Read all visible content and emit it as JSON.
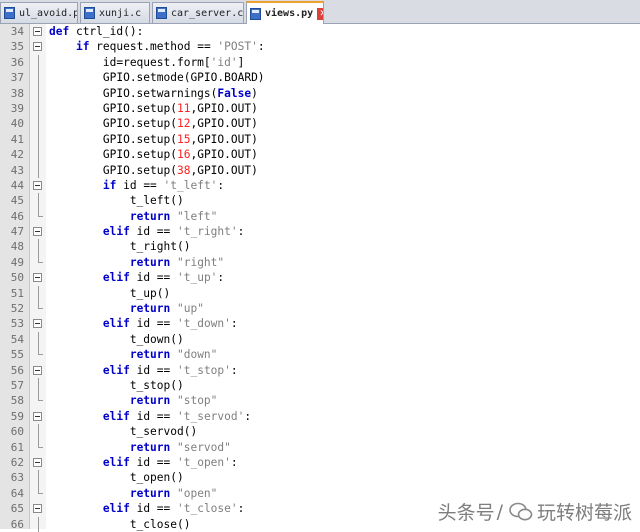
{
  "tabs": [
    {
      "label": "ul_avoid.py",
      "active": false
    },
    {
      "label": "xunji.c",
      "active": false
    },
    {
      "label": "car_server.c",
      "active": false
    },
    {
      "label": "views.py",
      "active": true
    }
  ],
  "code_lines": [
    {
      "n": "34",
      "t": [
        [
          "kw",
          "def "
        ],
        [
          "p",
          "ctrl_id():"
        ]
      ]
    },
    {
      "n": "35",
      "t": [
        [
          "p",
          "    "
        ],
        [
          "kw",
          "if "
        ],
        [
          "p",
          "request.method == "
        ],
        [
          "str",
          "'POST'"
        ],
        [
          "p",
          ":"
        ]
      ]
    },
    {
      "n": "36",
      "t": [
        [
          "p",
          "        id=request.form["
        ],
        [
          "str",
          "'id'"
        ],
        [
          "p",
          "]"
        ]
      ]
    },
    {
      "n": "37",
      "t": [
        [
          "p",
          "        GPIO.setmode(GPIO.BOARD)"
        ]
      ]
    },
    {
      "n": "38",
      "t": [
        [
          "p",
          "        GPIO.setwarnings("
        ],
        [
          "kw",
          "False"
        ],
        [
          "p",
          ")"
        ]
      ]
    },
    {
      "n": "39",
      "t": [
        [
          "p",
          "        GPIO.setup("
        ],
        [
          "num",
          "11"
        ],
        [
          "p",
          ",GPIO.OUT)"
        ]
      ]
    },
    {
      "n": "40",
      "t": [
        [
          "p",
          "        GPIO.setup("
        ],
        [
          "num",
          "12"
        ],
        [
          "p",
          ",GPIO.OUT)"
        ]
      ]
    },
    {
      "n": "41",
      "t": [
        [
          "p",
          "        GPIO.setup("
        ],
        [
          "num",
          "15"
        ],
        [
          "p",
          ",GPIO.OUT)"
        ]
      ]
    },
    {
      "n": "42",
      "t": [
        [
          "p",
          "        GPIO.setup("
        ],
        [
          "num",
          "16"
        ],
        [
          "p",
          ",GPIO.OUT)"
        ]
      ]
    },
    {
      "n": "43",
      "t": [
        [
          "p",
          "        GPIO.setup("
        ],
        [
          "num",
          "38"
        ],
        [
          "p",
          ",GPIO.OUT)"
        ]
      ]
    },
    {
      "n": "44",
      "t": [
        [
          "p",
          "        "
        ],
        [
          "kw",
          "if "
        ],
        [
          "p",
          "id == "
        ],
        [
          "str",
          "'t_left'"
        ],
        [
          "p",
          ":"
        ]
      ]
    },
    {
      "n": "45",
      "t": [
        [
          "p",
          "            t_left()"
        ]
      ]
    },
    {
      "n": "46",
      "t": [
        [
          "p",
          "            "
        ],
        [
          "kw",
          "return "
        ],
        [
          "str",
          "\"left\""
        ]
      ]
    },
    {
      "n": "47",
      "t": [
        [
          "p",
          "        "
        ],
        [
          "kw",
          "elif "
        ],
        [
          "p",
          "id == "
        ],
        [
          "str",
          "'t_right'"
        ],
        [
          "p",
          ":"
        ]
      ]
    },
    {
      "n": "48",
      "t": [
        [
          "p",
          "            t_right()"
        ]
      ]
    },
    {
      "n": "49",
      "t": [
        [
          "p",
          "            "
        ],
        [
          "kw",
          "return "
        ],
        [
          "str",
          "\"right\""
        ]
      ]
    },
    {
      "n": "50",
      "t": [
        [
          "p",
          "        "
        ],
        [
          "kw",
          "elif "
        ],
        [
          "p",
          "id == "
        ],
        [
          "str",
          "'t_up'"
        ],
        [
          "p",
          ":"
        ]
      ]
    },
    {
      "n": "51",
      "t": [
        [
          "p",
          "            t_up()"
        ]
      ]
    },
    {
      "n": "52",
      "t": [
        [
          "p",
          "            "
        ],
        [
          "kw",
          "return "
        ],
        [
          "str",
          "\"up\""
        ]
      ]
    },
    {
      "n": "53",
      "t": [
        [
          "p",
          "        "
        ],
        [
          "kw",
          "elif "
        ],
        [
          "p",
          "id == "
        ],
        [
          "str",
          "'t_down'"
        ],
        [
          "p",
          ":"
        ]
      ]
    },
    {
      "n": "54",
      "t": [
        [
          "p",
          "            t_down()"
        ]
      ]
    },
    {
      "n": "55",
      "t": [
        [
          "p",
          "            "
        ],
        [
          "kw",
          "return "
        ],
        [
          "str",
          "\"down\""
        ]
      ]
    },
    {
      "n": "56",
      "t": [
        [
          "p",
          "        "
        ],
        [
          "kw",
          "elif "
        ],
        [
          "p",
          "id == "
        ],
        [
          "str",
          "'t_stop'"
        ],
        [
          "p",
          ":"
        ]
      ]
    },
    {
      "n": "57",
      "t": [
        [
          "p",
          "            t_stop()"
        ]
      ]
    },
    {
      "n": "58",
      "t": [
        [
          "p",
          "            "
        ],
        [
          "kw",
          "return "
        ],
        [
          "str",
          "\"stop\""
        ]
      ]
    },
    {
      "n": "59",
      "t": [
        [
          "p",
          "        "
        ],
        [
          "kw",
          "elif "
        ],
        [
          "p",
          "id == "
        ],
        [
          "str",
          "'t_servod'"
        ],
        [
          "p",
          ":"
        ]
      ]
    },
    {
      "n": "60",
      "t": [
        [
          "p",
          "            t_servod()"
        ]
      ]
    },
    {
      "n": "61",
      "t": [
        [
          "p",
          "            "
        ],
        [
          "kw",
          "return "
        ],
        [
          "str",
          "\"servod\""
        ]
      ]
    },
    {
      "n": "62",
      "t": [
        [
          "p",
          "        "
        ],
        [
          "kw",
          "elif "
        ],
        [
          "p",
          "id == "
        ],
        [
          "str",
          "'t_open'"
        ],
        [
          "p",
          ":"
        ]
      ]
    },
    {
      "n": "63",
      "t": [
        [
          "p",
          "            t_open()"
        ]
      ]
    },
    {
      "n": "64",
      "t": [
        [
          "p",
          "            "
        ],
        [
          "kw",
          "return "
        ],
        [
          "str",
          "\"open\""
        ]
      ]
    },
    {
      "n": "65",
      "t": [
        [
          "p",
          "        "
        ],
        [
          "kw",
          "elif "
        ],
        [
          "p",
          "id == "
        ],
        [
          "str",
          "'t_close'"
        ],
        [
          "p",
          ":"
        ]
      ]
    },
    {
      "n": "66",
      "t": [
        [
          "p",
          "            t_close()"
        ]
      ]
    }
  ],
  "fold_markers": {
    "box_lines": [
      "34",
      "35",
      "44",
      "47",
      "50",
      "53",
      "56",
      "59",
      "62",
      "65"
    ],
    "end_lines": [
      "46",
      "49",
      "52",
      "55",
      "58",
      "61",
      "64"
    ]
  },
  "watermark": {
    "prefix": "头条号",
    "separator": "/",
    "name": "玩转树莓派",
    "logo_name": "玩转树莓派"
  },
  "colors": {
    "keyword": "#0000c8",
    "string": "#7f7f7f",
    "number": "#ff2020",
    "line_number": "#6e6e6e",
    "active_tab_accent": "#f0a030"
  }
}
